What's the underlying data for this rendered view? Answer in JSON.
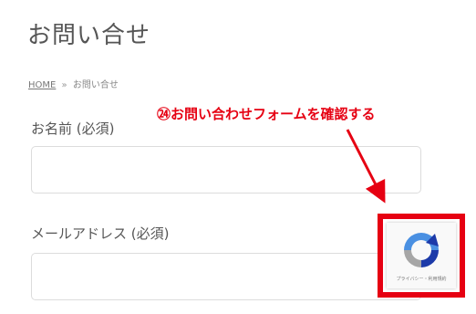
{
  "page": {
    "title": "お問い合せ"
  },
  "breadcrumb": {
    "home": "HOME",
    "separator": "»",
    "current": "お問い合せ"
  },
  "form": {
    "name_label": "お名前 (必須)",
    "name_value": "",
    "email_label": "メールアドレス (必須)",
    "email_value": ""
  },
  "annotation": {
    "text": "㉔お問い合わせフォームを確認する",
    "color": "#e60012"
  },
  "recaptcha": {
    "icon": "recaptcha-icon",
    "footer_text": "プライバシー・利用規約"
  }
}
